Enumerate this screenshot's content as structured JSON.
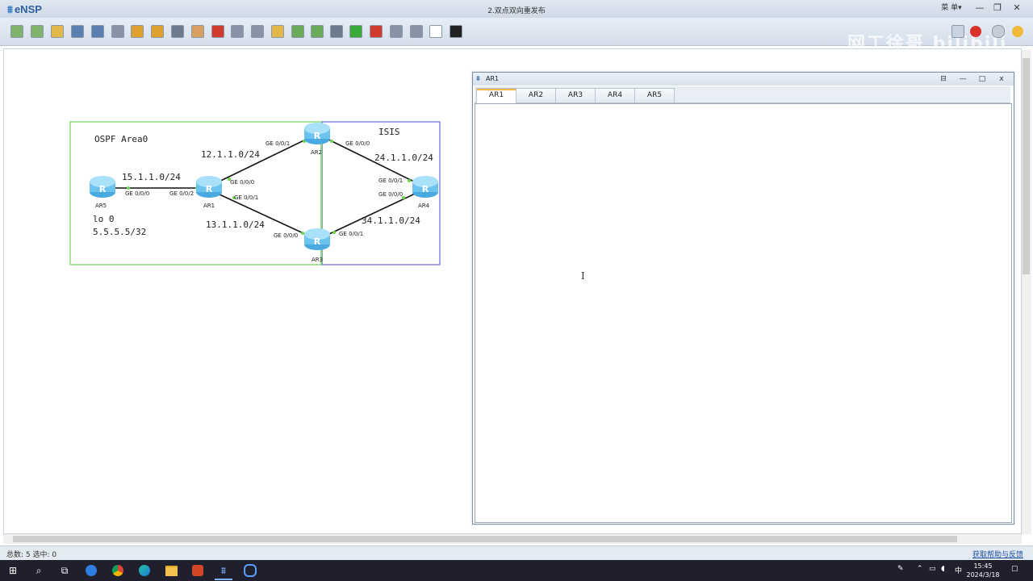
{
  "app": {
    "name": "eNSP",
    "document_title": "2.双点双向重发布",
    "menu_label": "菜 单▾"
  },
  "window_buttons": {
    "minimize": "—",
    "restore": "❐",
    "close": "✕"
  },
  "toolbar_icons": [
    "new-topology-icon",
    "new-example-icon",
    "open-icon",
    "save-icon",
    "save-as-icon",
    "print-icon",
    "undo-icon",
    "redo-icon",
    "select-icon",
    "pan-icon",
    "delete-icon",
    "delete-links-icon",
    "text-icon",
    "palette-icon",
    "zoom-in-icon",
    "zoom-out-icon",
    "fit-icon",
    "start-icon",
    "stop-icon",
    "capture-icon",
    "topology-icon",
    "blank-icon",
    "cli-icon"
  ],
  "right_toolbar_icons": [
    "chat-icon",
    "huawei-icon",
    "settings-icon",
    "help-icon"
  ],
  "watermark": "网工徐哥 bilibili",
  "topology": {
    "areas": [
      {
        "id": "ospf",
        "label": "OSPF Area0",
        "color": "#8fdc7a"
      },
      {
        "id": "isis",
        "label": "ISIS",
        "color": "#6a6adc"
      }
    ],
    "routers": [
      {
        "id": "AR5",
        "label": "AR5"
      },
      {
        "id": "AR1",
        "label": "AR1"
      },
      {
        "id": "AR2",
        "label": "AR2"
      },
      {
        "id": "AR3",
        "label": "AR3"
      },
      {
        "id": "AR4",
        "label": "AR4"
      }
    ],
    "subnets": [
      "15.1.1.0/24",
      "12.1.1.0/24",
      "13.1.1.0/24",
      "24.1.1.0/24",
      "34.1.1.0/24"
    ],
    "ports": {
      "ar5_g000": "GE 0/0/0",
      "ar1_g002": "GE 0/0/2",
      "ar1_g000": "GE 0/0/0",
      "ar1_g001": "GE 0/0/1",
      "ar2_g001": "GE 0/0/1",
      "ar2_g000": "GE 0/0/0",
      "ar3_g000": "GE 0/0/0",
      "ar3_g001": "GE 0/0/1",
      "ar4_g001": "GE 0/0/1",
      "ar4_g000": "GE 0/0/0"
    },
    "loopback": {
      "name": "lo 0",
      "address": "5.5.5.5/32"
    }
  },
  "console": {
    "title": "AR1",
    "tabs": [
      "AR1",
      "AR2",
      "AR3",
      "AR4",
      "AR5"
    ],
    "active_tab": "AR1",
    "buttons": {
      "pin": "⊟",
      "minimize": "—",
      "maximize": "□",
      "close": "x"
    }
  },
  "status": {
    "left": "总数: 5 选中: 0",
    "right": "获取帮助与反馈"
  },
  "taskbar": {
    "apps": [
      "start-icon",
      "search-icon",
      "task-view-icon",
      "app-blue-icon",
      "chrome-icon",
      "edge-icon",
      "file-explorer-icon",
      "powerpoint-icon",
      "ensp-icon",
      "search-app-icon"
    ],
    "tray": {
      "ime": "中"
    },
    "time": "15:45",
    "date": "2024/3/18"
  }
}
